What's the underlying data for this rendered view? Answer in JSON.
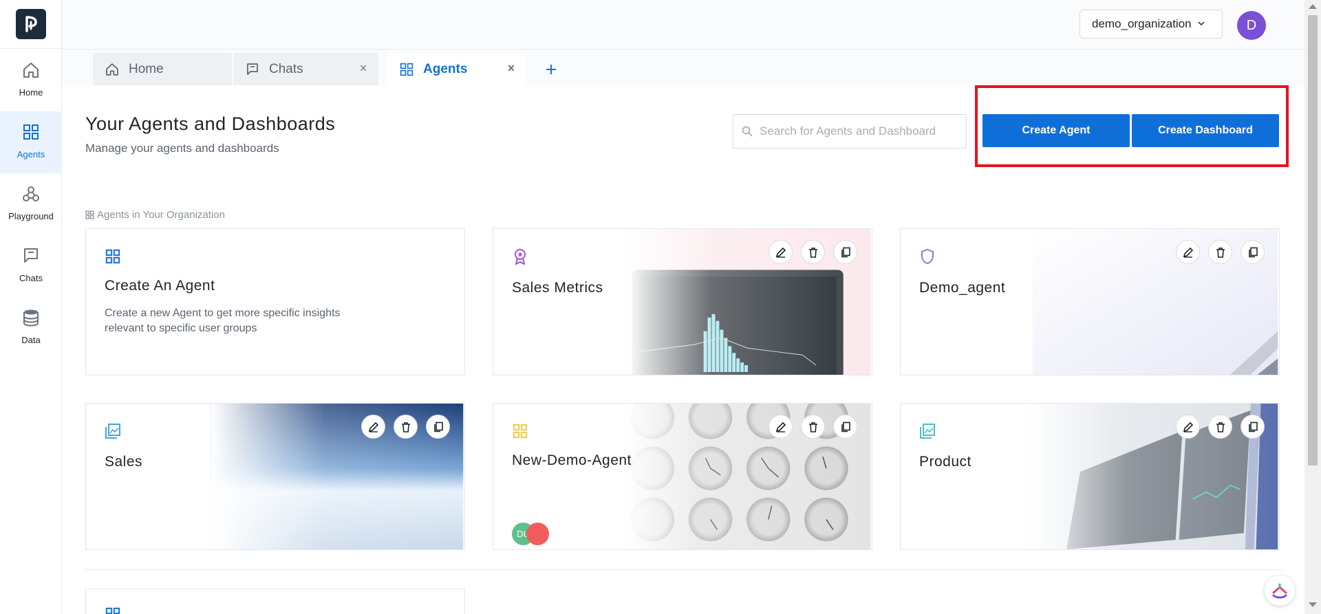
{
  "org": {
    "name": "demo_organization",
    "avatar_initial": "D"
  },
  "sidebar": {
    "items": [
      {
        "label": "Home",
        "icon": "home-icon"
      },
      {
        "label": "Agents",
        "icon": "grid-icon"
      },
      {
        "label": "Playground",
        "icon": "webhook-icon"
      },
      {
        "label": "Chats",
        "icon": "chat-icon"
      },
      {
        "label": "Data",
        "icon": "database-icon"
      }
    ]
  },
  "tabs": [
    {
      "label": "Home",
      "icon": "home-icon"
    },
    {
      "label": "Chats",
      "icon": "chat-icon",
      "close": "×"
    },
    {
      "label": "Agents",
      "icon": "grid-icon",
      "close": "×"
    }
  ],
  "header": {
    "title": "Your Agents and Dashboards",
    "subtitle": "Manage your agents and dashboards"
  },
  "search": {
    "placeholder": "Search for Agents and Dashboard"
  },
  "buttons": {
    "create_agent": "Create Agent",
    "create_dashboard": "Create Dashboard"
  },
  "section": {
    "label": "Agents in Your Organization"
  },
  "cards": [
    {
      "title": "Create An Agent",
      "description": "Create a new Agent to get more specific insights relevant to specific user groups",
      "icon": "grid-icon"
    },
    {
      "title": "Sales Metrics",
      "icon": "award-icon"
    },
    {
      "title": "Demo_agent",
      "icon": "shield-icon"
    },
    {
      "title": "Sales",
      "icon": "image-stack-icon"
    },
    {
      "title": "New-Demo-Agent",
      "icon": "grid-icon",
      "avatars": [
        "DU",
        ""
      ]
    },
    {
      "title": "Product",
      "icon": "image-stack-icon"
    }
  ],
  "colors": {
    "accent": "#0f6fd9",
    "highlight": "#e5131e",
    "avatar": "#7b4fd6"
  }
}
